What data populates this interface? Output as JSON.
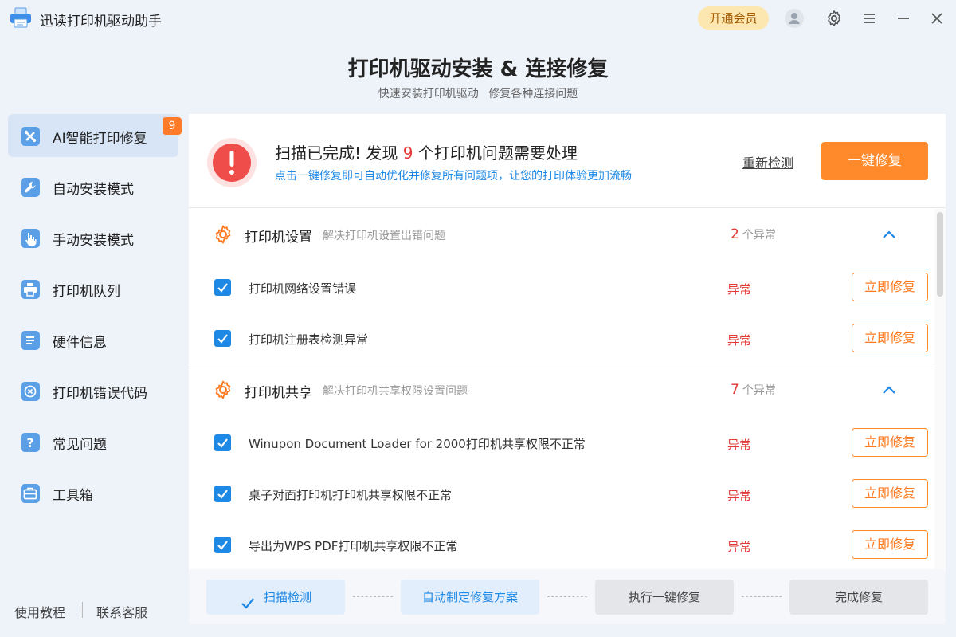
{
  "app": {
    "title": "迅读打印机驱动助手",
    "vip_label": "开通会员"
  },
  "header": {
    "title": "打印机驱动安装 & 连接修复",
    "subtitle": "快速安装打印机驱动 修复各种连接问题"
  },
  "sidebar": {
    "items": [
      {
        "label": "AI智能打印修复",
        "badge": "9",
        "icon": "tools-icon",
        "active": true
      },
      {
        "label": "自动安装模式",
        "icon": "wrench-icon"
      },
      {
        "label": "手动安装模式",
        "icon": "hand-pointer-icon"
      },
      {
        "label": "打印机队列",
        "icon": "printer-icon"
      },
      {
        "label": "硬件信息",
        "icon": "list-icon"
      },
      {
        "label": "打印机错误代码",
        "icon": "error-x-icon"
      },
      {
        "label": "常见问题",
        "icon": "question-icon"
      },
      {
        "label": "工具箱",
        "icon": "toolbox-icon"
      }
    ],
    "footer": {
      "tutorial": "使用教程",
      "support": "联系客服"
    }
  },
  "summary": {
    "title_prefix": "扫描已完成! 发现",
    "count": "9",
    "title_suffix": "个打印机问题需要处理",
    "subtitle": "点击一键修复即可自动优化并修复所有问题项，让您的打印体验更加流畅",
    "recheck_label": "重新检测",
    "fix_all_label": "一键修复"
  },
  "groups": [
    {
      "title": "打印机设置",
      "desc": "解决打印机设置出错问题",
      "count": "2",
      "count_unit": "个异常",
      "issues": [
        {
          "name": "打印机网络设置错误",
          "status": "异常",
          "action": "立即修复"
        },
        {
          "name": "打印机注册表检测异常",
          "status": "异常",
          "action": "立即修复"
        }
      ]
    },
    {
      "title": "打印机共享",
      "desc": "解决打印机共享权限设置问题",
      "count": "7",
      "count_unit": "个异常",
      "issues": [
        {
          "name": "Winupon Document Loader for 2000打印机共享权限不正常",
          "status": "异常",
          "action": "立即修复"
        },
        {
          "name": "桌子对面打印机打印机共享权限不正常",
          "status": "异常",
          "action": "立即修复"
        },
        {
          "name": "导出为WPS PDF打印机共享权限不正常",
          "status": "异常",
          "action": "立即修复"
        }
      ]
    }
  ],
  "steps": [
    {
      "label": "扫描检测",
      "state": "done"
    },
    {
      "label": "自动制定修复方案",
      "state": "done"
    },
    {
      "label": "执行一键修复",
      "state": "todo"
    },
    {
      "label": "完成修复",
      "state": "todo"
    }
  ],
  "colors": {
    "accent": "#1e88e5",
    "orange": "#ff8a2b",
    "error": "#e53935"
  }
}
